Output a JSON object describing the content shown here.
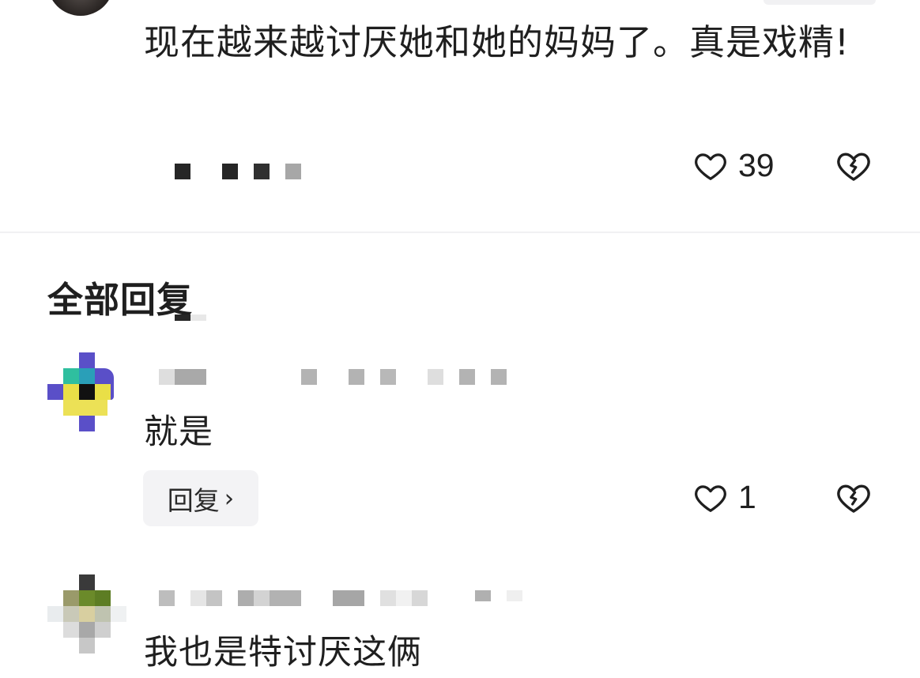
{
  "comment": {
    "text": "现在越来越讨厌她和她的妈妈了。真是戏精!",
    "likes": "39",
    "like_icon": "heart-outline-icon",
    "dislike_icon": "broken-heart-icon"
  },
  "replies_section": {
    "title": "全部回复"
  },
  "replies": [
    {
      "text": "就是",
      "reply_label": "回复",
      "reply_chevron": "›",
      "likes": "1"
    },
    {
      "text": "我也是特讨厌这俩"
    }
  ],
  "colors": {
    "text": "#1f1f1f",
    "divider": "#f1f1f3",
    "button_bg": "#f3f3f5"
  }
}
